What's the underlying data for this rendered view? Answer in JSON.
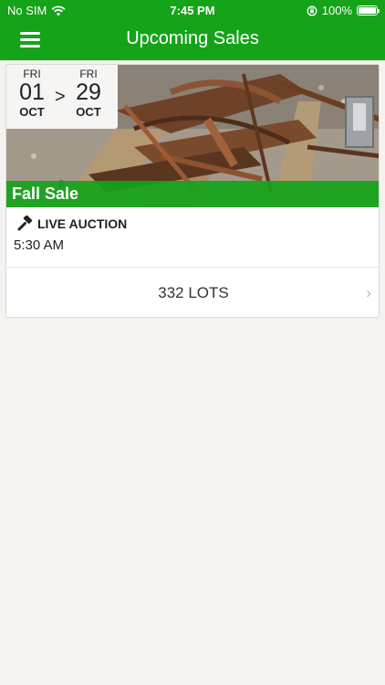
{
  "status_bar": {
    "carrier": "No SIM",
    "time": "7:45 PM",
    "battery": "100%"
  },
  "nav": {
    "title": "Upcoming Sales"
  },
  "sale": {
    "start": {
      "dow": "FRI",
      "day": "01",
      "month": "OCT"
    },
    "separator": ">",
    "end": {
      "dow": "FRI",
      "day": "29",
      "month": "OCT"
    },
    "name": "Fall Sale",
    "auction_type": "LIVE AUCTION",
    "time": "5:30 AM",
    "lots": "332 LOTS"
  },
  "colors": {
    "brand": "#15a31a",
    "background": "#f4f3ef"
  },
  "icons": [
    "wifi-icon",
    "orientation-lock-icon",
    "battery-icon",
    "menu-icon",
    "gavel-icon",
    "chevron-right-icon"
  ]
}
